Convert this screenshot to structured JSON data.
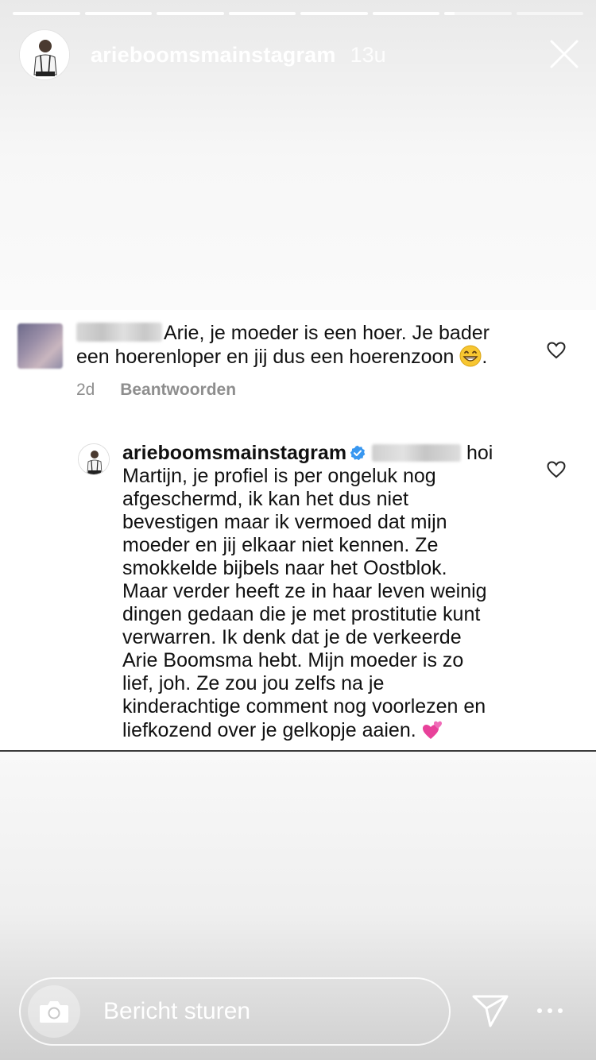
{
  "story": {
    "username": "arieboomsmainstagram",
    "time": "13u",
    "progress": [
      1,
      1,
      1,
      1,
      1,
      1,
      0.15,
      0
    ]
  },
  "comment1": {
    "text_line1": "Arie, je moeder is een hoer. Je bader",
    "text_line2_pre": "een hoerenloper en jij dus een hoerenzoon ",
    "text_line2_post": ".",
    "age": "2d",
    "reply_label": "Beantwoorden"
  },
  "comment2": {
    "username": "arieboomsmainstagram",
    "line1_tail": "hoi",
    "lines": [
      "Martijn, je profiel is per ongeluk nog",
      "afgeschermd, ik kan het dus niet",
      "bevestigen maar ik vermoed dat mijn",
      "moeder en jij elkaar niet kennen. Ze",
      "smokkelde bijbels naar het Oostblok.",
      "Maar verder heeft ze in haar leven weinig",
      "dingen gedaan die je met prostitutie kunt",
      "verwarren. Ik denk dat je de verkeerde",
      "Arie Boomsma hebt. Mijn moeder is zo",
      "lief, joh. Ze zou jou zelfs na je",
      "kinderachtige comment nog voorlezen en"
    ],
    "last_line": "liefkozend over je gelkopje aaien. "
  },
  "bottom": {
    "message_placeholder": "Bericht sturen"
  },
  "icons": {
    "close": "close-icon",
    "heart": "heart-outline-icon",
    "camera": "camera-icon",
    "send": "send-direct-icon",
    "more": "more-dots-icon",
    "verified": "verified-badge-icon",
    "emoji1": "grinning-face-emoji",
    "emoji2": "two-hearts-emoji"
  },
  "colors": {
    "verified": "#3897f0",
    "meta_gray": "#8e8e8e",
    "text": "#111111"
  }
}
